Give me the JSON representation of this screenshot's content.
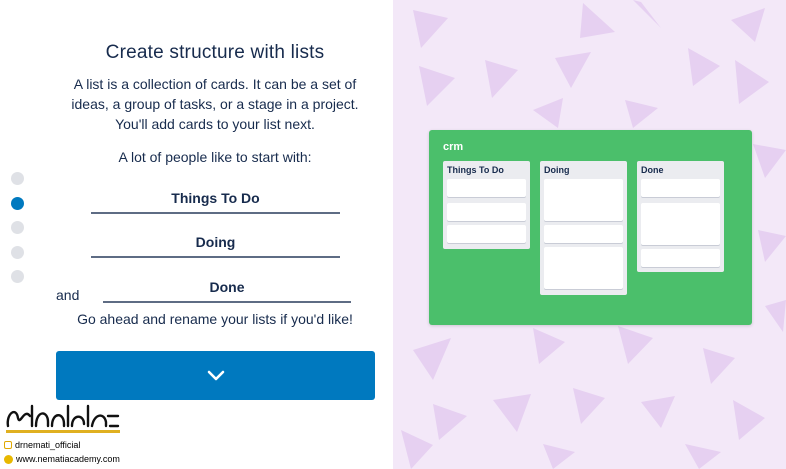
{
  "left": {
    "title": "Create structure with lists",
    "description": "A list is a collection of cards. It can be a set of ideas, a group of tasks, or a stage in a project. You'll add cards to your list next.",
    "hint": "A lot of people like to start with:",
    "fields": [
      "Things To Do",
      "Doing",
      "Done"
    ],
    "and_label": "and",
    "rename_hint": "Go ahead and rename your lists if you'd like!",
    "next_icon": "chevron-down-icon",
    "steps": {
      "count": 5,
      "active": 2
    }
  },
  "board": {
    "name": "crm",
    "color": "#4bbf6b",
    "lists": [
      {
        "title": "Things To Do"
      },
      {
        "title": "Doing"
      },
      {
        "title": "Done"
      }
    ]
  },
  "watermark": {
    "handle": "drnemati_official",
    "site": "www.nematiacademy.com"
  },
  "colors": {
    "accent": "#0079bf",
    "pattern_bg": "#f3e8f8",
    "pattern_triangle": "#e6d0f1"
  }
}
